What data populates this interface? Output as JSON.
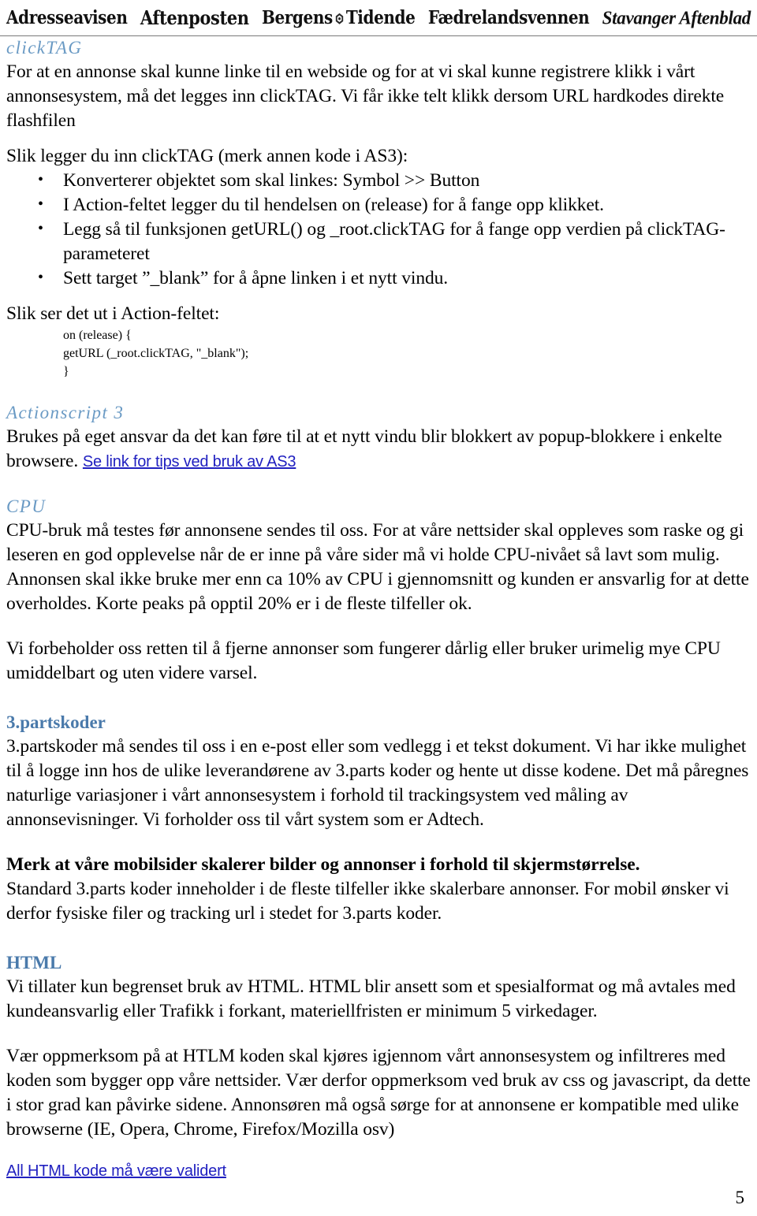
{
  "masthead": {
    "logos": [
      {
        "name": "adresseavisen",
        "text": "Adresseavisen"
      },
      {
        "name": "aftenposten",
        "text": "Aftenposten"
      },
      {
        "name": "bergens-tidende-left",
        "text": "Bergens"
      },
      {
        "name": "bergens-tidende-right",
        "text": "Tidende"
      },
      {
        "name": "fadrelandsvennen",
        "text": "Fædrelandsvennen"
      },
      {
        "name": "stavanger-aftenblad",
        "text": "Stavanger Aftenblad"
      }
    ]
  },
  "colors": {
    "heading_italic": "#6a9ac4",
    "heading_bold": "#4a7aab",
    "link": "#2020c0",
    "text": "#000000"
  },
  "sections": {
    "clicktag": {
      "heading": "clickTAG",
      "intro": "For at en annonse skal kunne linke til en webside og for at vi skal kunne registrere klikk i vårt annonsesystem, må det legges inn clickTAG. Vi får ikke telt klikk dersom URL hardkodes direkte flashfilen",
      "steps_lead": "Slik legger du inn clickTAG (merk annen kode i AS3):",
      "steps": [
        "Konverterer objektet som skal linkes: Symbol >> Button",
        "I Action-feltet legger du til hendelsen on (release) for å fange opp klikket.",
        "Legg så til funksjonen getURL() og _root.clickTAG for å fange opp verdien på clickTAG-parameteret",
        "Sett target ”_blank” for å åpne linken i et nytt vindu."
      ],
      "code_lead": "Slik ser det ut i Action-feltet:",
      "code": "on (release) {\ngetURL (_root.clickTAG, \"_blank\");\n}"
    },
    "actionscript3": {
      "heading": "Actionscript 3",
      "body": "Brukes på eget ansvar da det kan føre til at et nytt vindu blir blokkert av popup-blokkere i enkelte browsere. ",
      "link": "Se link for tips ved bruk av AS3"
    },
    "cpu": {
      "heading": "CPU",
      "body": "CPU-bruk må testes før annonsene sendes til oss. For at våre nettsider skal oppleves som raske og gi leseren en god opplevelse når de er inne på våre sider må vi holde CPU-nivået så lavt som mulig. Annonsen skal ikke bruke mer enn ca 10% av CPU i gjennomsnitt og kunden er ansvarlig for at dette overholdes. Korte peaks på opptil 20% er i de fleste tilfeller ok.",
      "body2": "Vi forbeholder oss retten til å fjerne annonser som fungerer dårlig eller bruker urimelig mye CPU umiddelbart og uten videre varsel."
    },
    "partskoder": {
      "heading": "3.partskoder",
      "body": "3.partskoder må sendes til oss i en e-post eller som vedlegg i et tekst dokument. Vi har ikke mulighet til å logge inn hos de ulike leverandørene av 3.parts koder og hente ut disse kodene. Det må påregnes naturlige variasjoner i vårt annonsesystem i forhold til trackingsystem ved måling av annonsevisninger. Vi forholder oss til vårt system som er Adtech.",
      "bold_note": "Merk at våre mobilsider skalerer bilder og annonser i forhold til skjermstørrelse.",
      "body2": "Standard 3.parts koder inneholder i de fleste tilfeller ikke skalerbare annonser. For mobil ønsker vi derfor fysiske filer og tracking url i stedet for 3.parts koder."
    },
    "html": {
      "heading": "HTML",
      "body": "Vi tillater kun begrenset bruk av HTML. HTML blir ansett som et spesialformat og må avtales med kundeansvarlig eller Trafikk i forkant, materiellfristen er minimum 5 virkedager.",
      "body2": "Vær oppmerksom på at HTLM koden skal kjøres igjennom vårt annonsesystem og infiltreres med koden som bygger opp våre nettsider. Vær derfor oppmerksom ved bruk av css og javascript, da dette i stor grad kan påvirke sidene. Annonsøren må også sørge for at annonsene er kompatible med ulike browserne (IE, Opera, Chrome, Firefox/Mozilla osv)",
      "link": "All HTML kode må være validert"
    }
  },
  "footer": {
    "page_number": "5"
  }
}
